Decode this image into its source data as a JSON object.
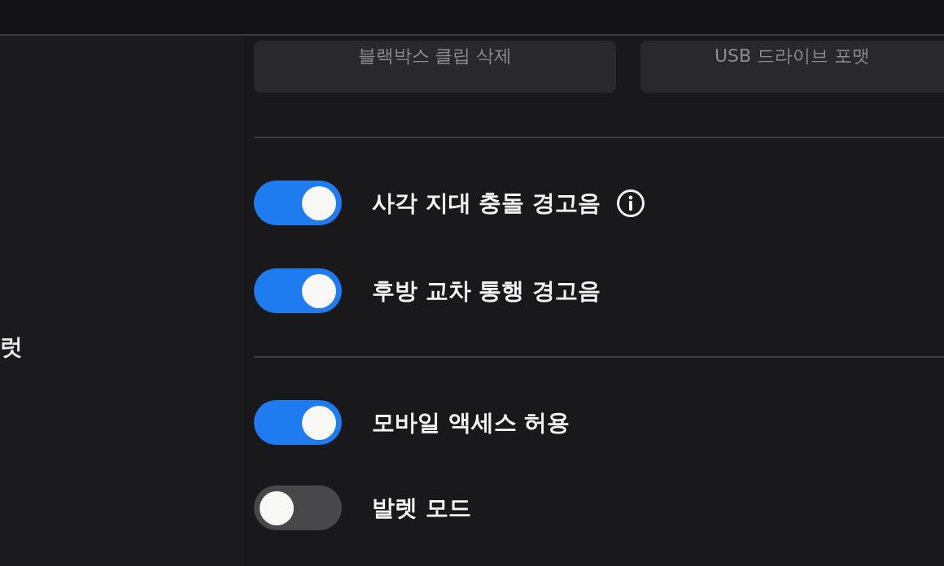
{
  "sidebar": {
    "items": [
      {
        "label": "럿"
      }
    ]
  },
  "actions": [
    {
      "label": "블랙박스 클립 삭제"
    },
    {
      "label": "USB 드라이브 포맷"
    }
  ],
  "toggle_groups": [
    {
      "toggles": [
        {
          "label": "사각 지대 충돌 경고음",
          "on": true,
          "info": true
        },
        {
          "label": "후방 교차 통행 경고음",
          "on": true,
          "info": false
        }
      ]
    },
    {
      "toggles": [
        {
          "label": "모바일 액세스 허용",
          "on": true,
          "info": false
        },
        {
          "label": "발렛 모드",
          "on": false,
          "info": false
        }
      ]
    }
  ]
}
